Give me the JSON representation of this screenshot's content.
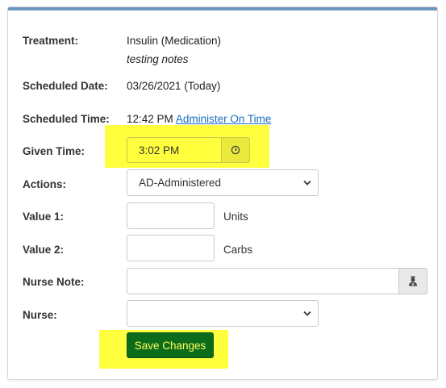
{
  "colors": {
    "highlight": "#ffff3e",
    "primary_button_bg": "#0d6b1c",
    "primary_button_text": "#ffff5a",
    "link": "#1a6fc2",
    "card_accent": "#6f96bd"
  },
  "treatment": {
    "label": "Treatment:",
    "value": "Insulin (Medication)",
    "note": "testing notes"
  },
  "scheduled_date": {
    "label": "Scheduled Date:",
    "value": "03/26/2021 (Today)"
  },
  "scheduled_time": {
    "label": "Scheduled Time:",
    "value": "12:42 PM",
    "link": "Administer On Time"
  },
  "given_time": {
    "label": "Given Time:",
    "value": "3:02 PM",
    "icon": "clock-icon"
  },
  "actions": {
    "label": "Actions:",
    "selected": "AD-Administered"
  },
  "value1": {
    "label": "Value 1:",
    "value": "",
    "unit": "Units"
  },
  "value2": {
    "label": "Value 2:",
    "value": "",
    "unit": "Carbs"
  },
  "nurse_note": {
    "label": "Nurse Note:",
    "value": "",
    "icon": "nurse-icon"
  },
  "nurse": {
    "label": "Nurse:",
    "selected": ""
  },
  "save_button": {
    "label": "Save Changes"
  }
}
